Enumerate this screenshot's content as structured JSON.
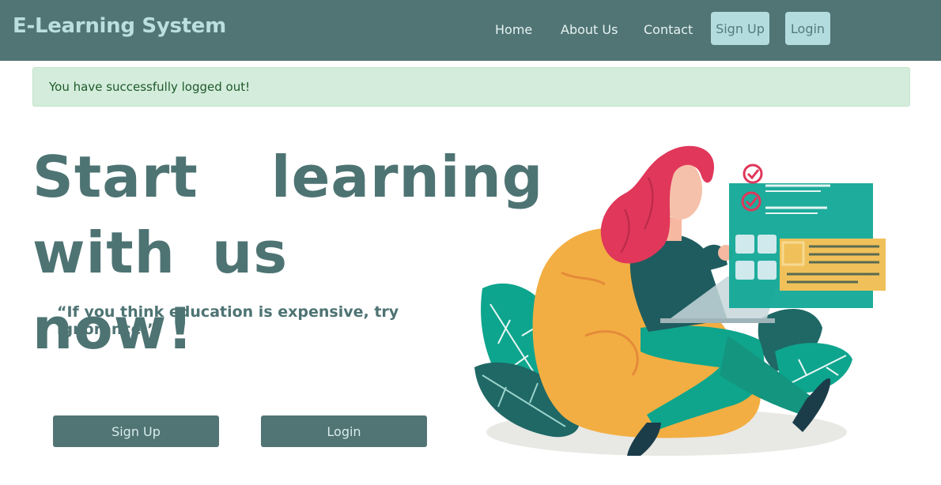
{
  "header": {
    "brand": "E-Learning System",
    "nav": {
      "home": "Home",
      "about": "About Us",
      "contact": "Contact",
      "signup": "Sign Up",
      "login": "Login"
    }
  },
  "alert": {
    "message": "You have successfully logged out!"
  },
  "hero": {
    "headline_line1": "Start  learning",
    "headline_line2": "with us now!",
    "quote": "“If you think education is expensive, try ignorance.”",
    "signup_button": "Sign Up",
    "login_button": "Login"
  },
  "colors": {
    "navbar": "#517474",
    "brand": "#b9dfdf",
    "nav_button": "#b3dcdf",
    "alert_bg": "#d4ecdb",
    "headline": "#4e7373"
  },
  "illustration": {
    "icon": "woman-studying-on-beanbag-illustration"
  }
}
